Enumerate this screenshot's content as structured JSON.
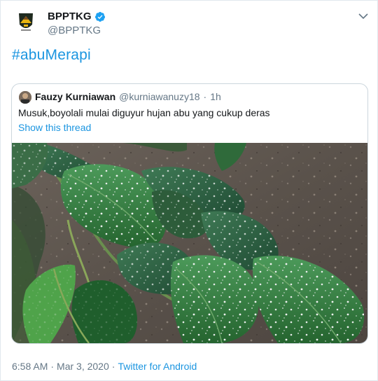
{
  "author": {
    "name": "BPPTKG",
    "handle": "@BPPTKG",
    "verified": true,
    "avatar_icon": "volcano-shield-logo-icon"
  },
  "tweet": {
    "text": "#abuMerapi"
  },
  "quoted_tweet": {
    "name": "Fauzy Kurniawan",
    "handle": "@kurniawanuzy18",
    "separator": "·",
    "time": "1h",
    "text": "Musuk,boyolali mulai diguyur hujan abu yang cukup deras",
    "show_thread": "Show this thread"
  },
  "footer": {
    "time": "6:58 AM",
    "separator1": "·",
    "date": "Mar 3, 2020",
    "separator2": "·",
    "source": "Twitter for Android"
  },
  "colors": {
    "link": "#1b95e0",
    "muted": "#657786",
    "border": "#ccd6dd"
  }
}
